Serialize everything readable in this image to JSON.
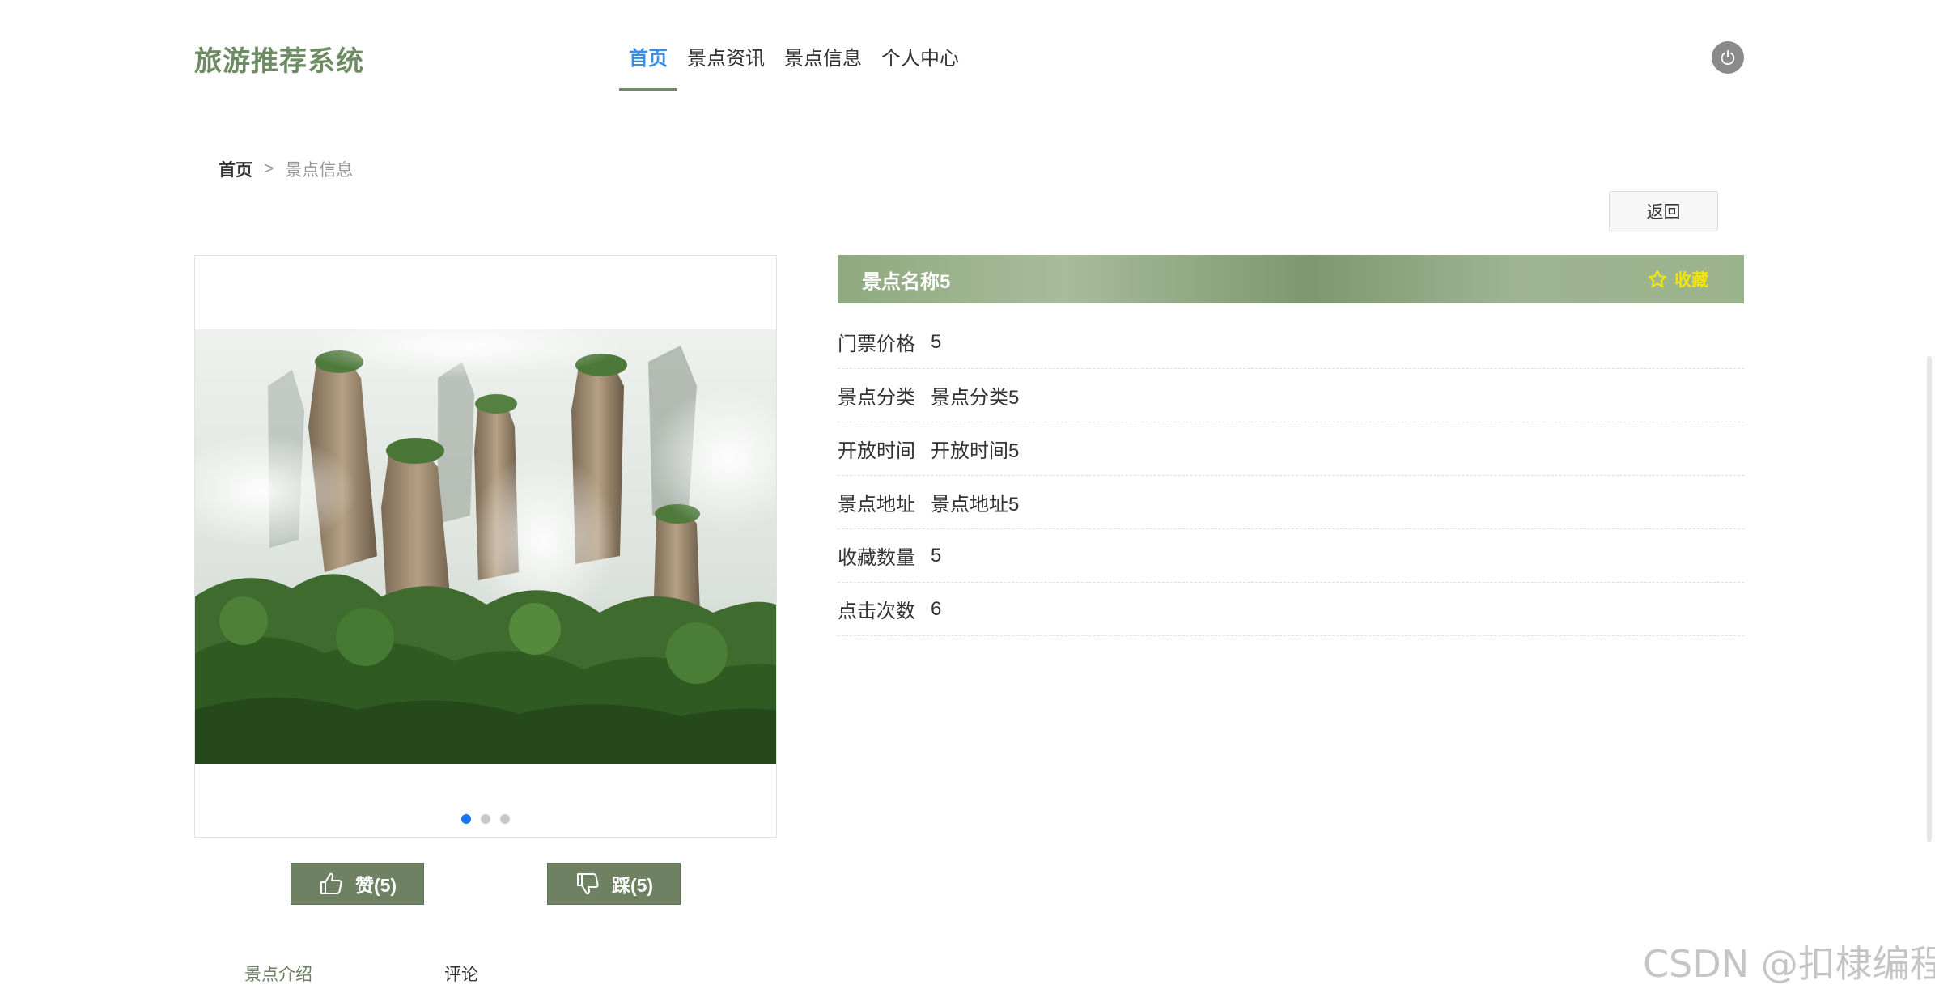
{
  "header": {
    "brand": "旅游推荐系统",
    "nav": [
      {
        "label": "首页",
        "active": true
      },
      {
        "label": "景点资讯",
        "active": false
      },
      {
        "label": "景点信息",
        "active": false
      },
      {
        "label": "个人中心",
        "active": false
      }
    ],
    "power_icon": "power-icon"
  },
  "breadcrumb": {
    "home": "首页",
    "separator": ">",
    "current": "景点信息"
  },
  "back_label": "返回",
  "carousel": {
    "slide_count": 3,
    "active_index": 0
  },
  "votes": {
    "like_label": "赞(5)",
    "dislike_label": "踩(5)"
  },
  "detail": {
    "title": "景点名称5",
    "favorite_label": "收藏",
    "rows": [
      {
        "label": "门票价格",
        "value": "5"
      },
      {
        "label": "景点分类",
        "value": "景点分类5"
      },
      {
        "label": "开放时间",
        "value": "开放时间5"
      },
      {
        "label": "景点地址",
        "value": "景点地址5"
      },
      {
        "label": "收藏数量",
        "value": "5"
      },
      {
        "label": "点击次数",
        "value": "6"
      }
    ]
  },
  "tabs": {
    "intro": "景点介绍",
    "comments": "评论"
  },
  "watermark": "CSDN @扣棣编程",
  "colors": {
    "brand": "#6e8c63",
    "nav_active": "#3a8ee6",
    "button_green": "#6e8263",
    "favorite_yellow": "#f2e600",
    "dot_active": "#1677ff"
  }
}
